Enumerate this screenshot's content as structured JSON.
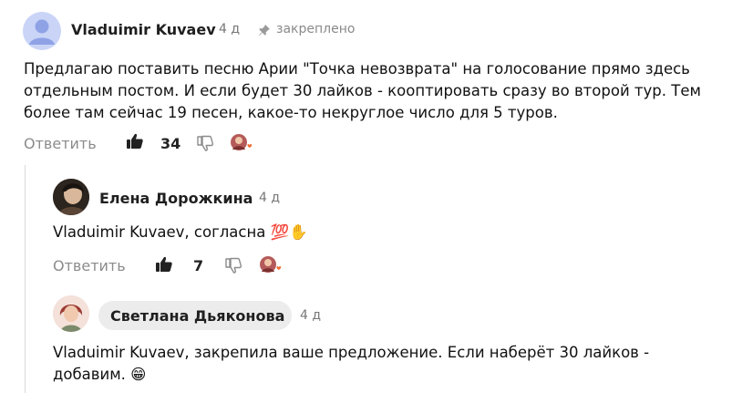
{
  "comments": [
    {
      "author": "Vladuimir Kuvaev",
      "time": "4 д",
      "pinned_label": "закреплено",
      "text": "Предлагаю поставить песню Арии \"Точка невозврата\" на голосование прямо здесь отдельным постом. И если будет 30 лайков - кооптировать сразу во второй тур. Тем более там сейчас 19 песен, какое-то некруглое число для 5 туров.",
      "reply_label": "Ответить",
      "likes": "34"
    },
    {
      "author": "Елена Дорожкина",
      "time": "4 д",
      "text": "Vladuimir Kuvaev, согласна 💯✋",
      "reply_label": "Ответить",
      "likes": "7"
    },
    {
      "author": "Светлана Дьяконова",
      "time": "4 д",
      "text": "Vladuimir Kuvaev, закрепила ваше предложение. Если наберёт 30 лайков - добавим. 😁"
    }
  ],
  "colors": {
    "thread_line": "#d9d9d9",
    "author_chip_bg": "#ececec",
    "like_icon": "#222222",
    "dislike_icon": "#8b8b8b",
    "heart": "#ef6b2e"
  },
  "icons": [
    "user-avatar-icon",
    "pin-icon",
    "thumb-up-icon",
    "thumb-down-icon",
    "reaction-heart-icon"
  ]
}
